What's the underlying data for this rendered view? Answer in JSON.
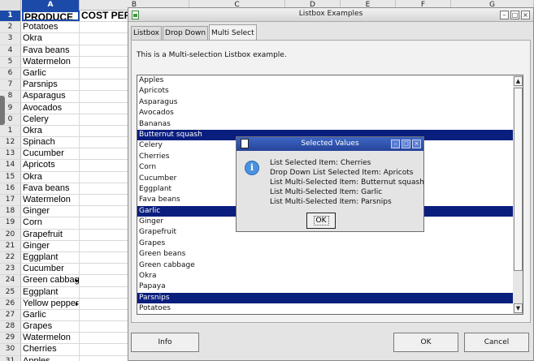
{
  "sheet": {
    "columns": [
      "A",
      "B",
      "C",
      "D",
      "E",
      "F",
      "G"
    ],
    "header_row_num": "1",
    "header_a": "PRODUCE",
    "header_b": "COST PER",
    "rows": [
      {
        "num": "2",
        "value": "Potatoes"
      },
      {
        "num": "3",
        "value": "Okra"
      },
      {
        "num": "4",
        "value": "Fava beans"
      },
      {
        "num": "5",
        "value": "Watermelon"
      },
      {
        "num": "6",
        "value": "Garlic"
      },
      {
        "num": "7",
        "value": "Parsnips"
      },
      {
        "num": "8",
        "value": "Asparagus"
      },
      {
        "num": "9",
        "value": "Avocados"
      },
      {
        "num": "0",
        "value": "Celery"
      },
      {
        "num": "1",
        "value": "Okra"
      },
      {
        "num": "12",
        "value": "Spinach"
      },
      {
        "num": "13",
        "value": "Cucumber"
      },
      {
        "num": "14",
        "value": "Apricots"
      },
      {
        "num": "15",
        "value": "Okra"
      },
      {
        "num": "16",
        "value": "Fava beans"
      },
      {
        "num": "17",
        "value": "Watermelon"
      },
      {
        "num": "18",
        "value": "Ginger"
      },
      {
        "num": "19",
        "value": "Corn"
      },
      {
        "num": "20",
        "value": "Grapefruit"
      },
      {
        "num": "21",
        "value": "Ginger"
      },
      {
        "num": "22",
        "value": "Eggplant"
      },
      {
        "num": "23",
        "value": "Cucumber"
      },
      {
        "num": "24",
        "value": "Green cabbag"
      },
      {
        "num": "25",
        "value": "Eggplant"
      },
      {
        "num": "26",
        "value": "Yellow pepper"
      },
      {
        "num": "27",
        "value": "Garlic"
      },
      {
        "num": "28",
        "value": "Grapes"
      },
      {
        "num": "29",
        "value": "Watermelon"
      },
      {
        "num": "30",
        "value": "Cherries"
      },
      {
        "num": "31",
        "value": "Apples"
      }
    ]
  },
  "dialog": {
    "title": "Listbox Examples",
    "tabs": [
      "Listbox",
      "Drop Down",
      "Multi Select"
    ],
    "active_tab": "Multi Select",
    "description": "This is a Multi-selection Listbox example.",
    "list_items": [
      {
        "label": "Apples",
        "selected": false
      },
      {
        "label": "Apricots",
        "selected": false
      },
      {
        "label": "Asparagus",
        "selected": false
      },
      {
        "label": "Avocados",
        "selected": false
      },
      {
        "label": "Bananas",
        "selected": false
      },
      {
        "label": "Butternut squash",
        "selected": true
      },
      {
        "label": "Celery",
        "selected": false
      },
      {
        "label": "Cherries",
        "selected": false
      },
      {
        "label": "Corn",
        "selected": false
      },
      {
        "label": "Cucumber",
        "selected": false
      },
      {
        "label": "Eggplant",
        "selected": false
      },
      {
        "label": "Fava beans",
        "selected": false
      },
      {
        "label": "Garlic",
        "selected": true
      },
      {
        "label": "Ginger",
        "selected": false
      },
      {
        "label": "Grapefruit",
        "selected": false
      },
      {
        "label": "Grapes",
        "selected": false
      },
      {
        "label": "Green beans",
        "selected": false
      },
      {
        "label": "Green cabbage",
        "selected": false
      },
      {
        "label": "Okra",
        "selected": false
      },
      {
        "label": "Papaya",
        "selected": false
      },
      {
        "label": "Parsnips",
        "selected": true
      },
      {
        "label": "Potatoes",
        "selected": false
      }
    ],
    "buttons": {
      "info": "Info",
      "ok": "OK",
      "cancel": "Cancel"
    },
    "window_controls": {
      "minimize": "–",
      "maximize": "□",
      "close": "×"
    }
  },
  "message_box": {
    "title": "Selected Values",
    "icon": "info-icon",
    "lines": [
      "List Selected Item: Cherries",
      "Drop Down List Selected Item: Apricots",
      "List Multi-Selected Item: Butternut squash",
      "List Multi-Selected Item: Garlic",
      "List Multi-Selected Item: Parsnips"
    ],
    "ok_label": "OK"
  },
  "colors": {
    "selection": "#0a1e7e",
    "titlebar_active": "#26449a",
    "header_selected": "#1c4aa8"
  }
}
